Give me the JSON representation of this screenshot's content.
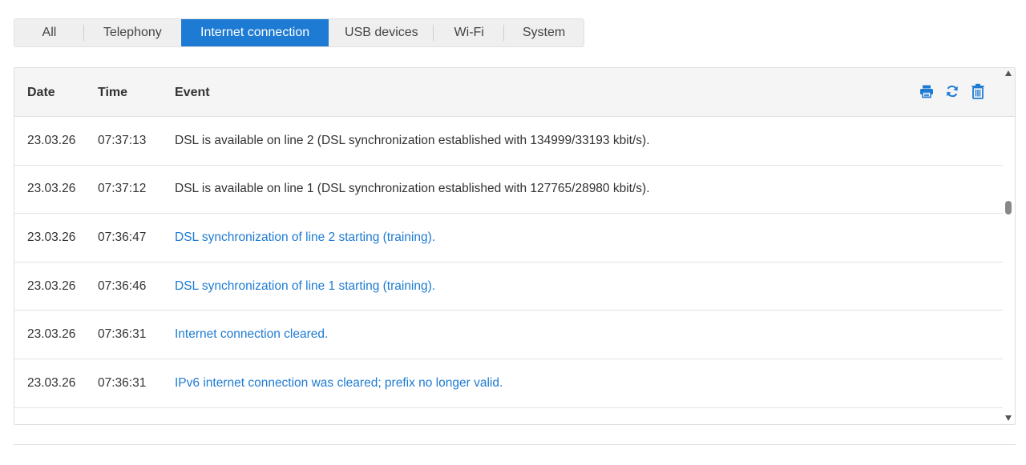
{
  "tabs": [
    {
      "label": "All"
    },
    {
      "label": "Telephony"
    },
    {
      "label": "Internet connection"
    },
    {
      "label": "USB devices"
    },
    {
      "label": "Wi-Fi"
    },
    {
      "label": "System"
    }
  ],
  "active_tab": "Internet connection",
  "table": {
    "headers": {
      "date": "Date",
      "time": "Time",
      "event": "Event"
    },
    "rows": [
      {
        "date": "23.03.26",
        "time": "07:37:13",
        "event": "DSL is available on line 2 (DSL synchronization established with 134999/33193 kbit/s)."
      },
      {
        "date": "23.03.26",
        "time": "07:37:12",
        "event": "DSL is available on line 1 (DSL synchronization established with 127765/28980 kbit/s)."
      },
      {
        "date": "23.03.26",
        "time": "07:36:47",
        "event": "DSL synchronization of line 2 starting (training)."
      },
      {
        "date": "23.03.26",
        "time": "07:36:46",
        "event": "DSL synchronization of line 1 starting (training)."
      },
      {
        "date": "23.03.26",
        "time": "07:36:31",
        "event": "Internet connection cleared."
      },
      {
        "date": "23.03.26",
        "time": "07:36:31",
        "event": "IPv6 internet connection was cleared; prefix no longer valid."
      }
    ]
  },
  "icons": {
    "print": "print-icon",
    "refresh": "refresh-icon",
    "delete": "trash-icon"
  },
  "colors": {
    "accent": "#1e7bd3",
    "link_text": "#1e7bd3",
    "text": "#333333"
  }
}
